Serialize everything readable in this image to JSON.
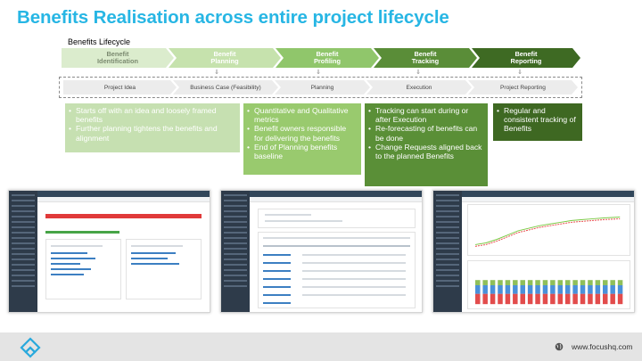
{
  "header": {
    "title": "Benefits Realisation across entire project lifecycle",
    "subtitle": "Benefits Lifecycle"
  },
  "stages": [
    {
      "label": "Benefit Identification",
      "color": "#dbeccd",
      "text_color": "#7b8a70"
    },
    {
      "label": "Benefit Planning",
      "color": "#c6e2ad"
    },
    {
      "label": "Benefit Profiling",
      "color": "#90c66b"
    },
    {
      "label": "Benefit Tracking",
      "color": "#5a8d38"
    },
    {
      "label": "Benefit Reporting",
      "color": "#3e6a23"
    }
  ],
  "phases": [
    "Project Idea",
    "Business Case (Feasibility)",
    "Planning",
    "Execution",
    "Project Reporting"
  ],
  "descriptions": [
    {
      "color": "#c6e0b1",
      "bullets": [
        "Starts off with an idea and loosely framed benefits",
        "Further planning tightens the benefits and alignment"
      ]
    },
    {
      "color": "#99ca6e",
      "bullets": [
        "Quantitative and Qualitative metrics",
        "Benefit owners responsible for delivering the benefits",
        "End of Planning benefits baseline"
      ]
    },
    {
      "color": "#5a8f37",
      "bullets": [
        "Tracking can start during or after Execution",
        "Re-forecasting of benefits can be done",
        "Change Requests aligned back to the planned Benefits"
      ]
    },
    {
      "color": "#3e6822",
      "bullets": [
        "Regular and consistent tracking of Benefits"
      ]
    }
  ],
  "screenshots": [
    {
      "name": "project-details-screenshot",
      "header": "PPM Software Evaluation - Project Details"
    },
    {
      "name": "benefits-tracking-screenshot",
      "header": "Transformation - Benefits Tracking"
    },
    {
      "name": "benefits-charts-screenshot",
      "header": ""
    }
  ],
  "footer": {
    "url": "www.focushq.com",
    "globe_icon": "globe-icon",
    "logo_icon": "focus-logo-icon"
  }
}
